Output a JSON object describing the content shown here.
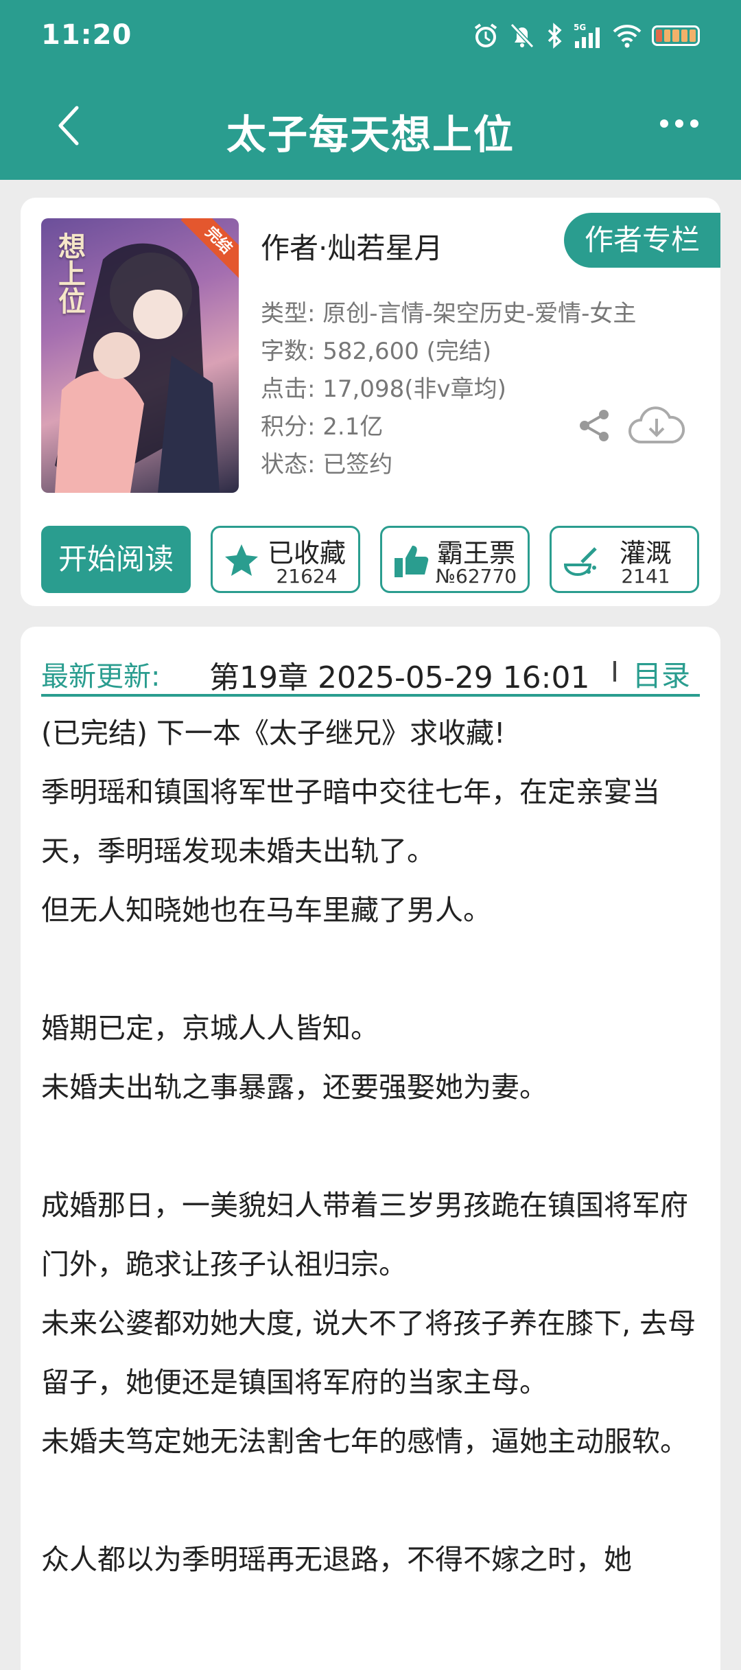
{
  "status": {
    "time": "11:20",
    "network": "5G"
  },
  "nav": {
    "title": "太子每天想上位"
  },
  "book": {
    "cover_title": "想上位",
    "cover_badge": "完结",
    "author": "作者·灿若星月",
    "author_column": "作者专栏",
    "meta": [
      "类型: 原创-言情-架空历史-爱情-女主",
      "字数: 582,600 (完结)",
      "点击: 17,098(非v章均)",
      "积分: 2.1亿",
      "状态: 已签约"
    ]
  },
  "actions": {
    "read": "开始阅读",
    "collect": {
      "label": "已收藏",
      "count": "21624"
    },
    "ticket": {
      "label": "霸王票",
      "count": "№62770"
    },
    "water": {
      "label": "灌溉",
      "count": "2141"
    }
  },
  "update": {
    "label": "最新更新:",
    "chapter": "第19章  2025-05-29 16:01",
    "toc": "目录"
  },
  "intro": [
    "(已完结) 下一本《太子继兄》求收藏!",
    "季明瑶和镇国将军世子暗中交往七年，在定亲宴当天，季明瑶发现未婚夫出轨了。",
    "但无人知晓她也在马车里藏了男人。",
    "",
    "婚期已定，京城人人皆知。",
    "未婚夫出轨之事暴露，还要强娶她为妻。",
    "",
    "成婚那日，一美貌妇人带着三岁男孩跪在镇国将军府门外，跪求让孩子认祖归宗。",
    "未来公婆都劝她大度, 说大不了将孩子养在膝下, 去母留子，她便还是镇国将军府的当家主母。",
    "未婚夫笃定她无法割舍七年的感情，逼她主动服软。",
    "",
    "众人都以为季明瑶再无退路，不得不嫁之时，她"
  ]
}
